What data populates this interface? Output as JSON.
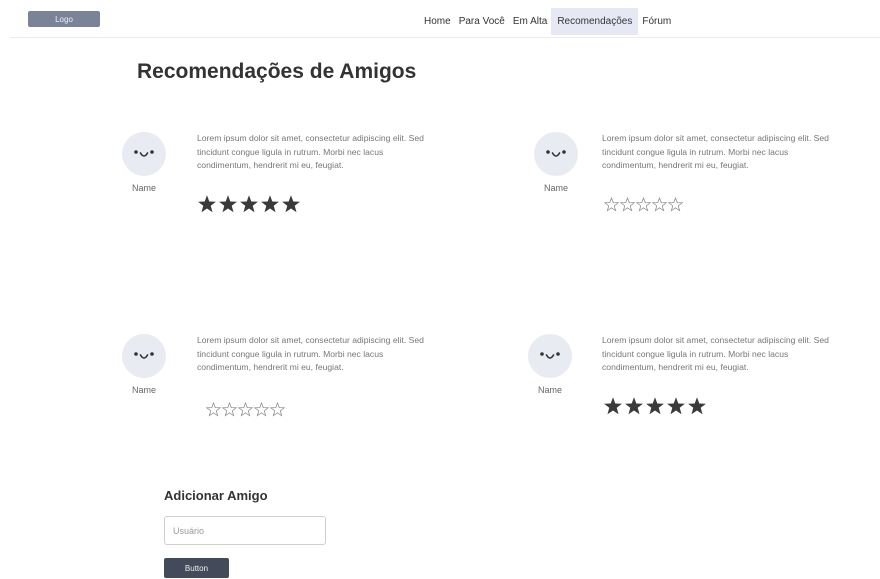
{
  "header": {
    "logo_label": "Logo",
    "nav": [
      {
        "label": "Home"
      },
      {
        "label": "Para Você"
      },
      {
        "label": "Em Alta"
      },
      {
        "label": "Recomendações",
        "active": true
      },
      {
        "label": "Fórum"
      }
    ]
  },
  "page_title": "Recomendações de Amigos",
  "cards": [
    {
      "name": "Name",
      "lines": [
        "Lorem ipsum dolor sit amet, consectetur adipiscing elit. Sed",
        "tincidunt congue ligula in rutrum. Morbi nec lacus",
        "condimentum, hendrerit mi eu, feugiat."
      ],
      "rating": 5,
      "max_rating": 5
    },
    {
      "name": "Name",
      "lines": [
        "Lorem ipsum dolor sit amet, consectetur adipiscing elit. Sed",
        "tincidunt congue ligula in rutrum. Morbi nec lacus",
        "condimentum, hendrerit mi eu, feugiat."
      ],
      "rating": 0,
      "max_rating": 5
    },
    {
      "name": "Name",
      "lines": [
        "Lorem ipsum dolor sit amet, consectetur adipiscing elit. Sed",
        "tincidunt congue ligula in rutrum. Morbi nec lacus",
        "condimentum, hendrerit mi eu, feugiat."
      ],
      "rating": 0,
      "max_rating": 5
    },
    {
      "name": "Name",
      "lines": [
        "Lorem ipsum dolor sit amet, consectetur adipiscing elit. Sed",
        "tincidunt congue ligula in rutrum. Morbi nec lacus",
        "condimentum, hendrerit mi eu, feugiat."
      ],
      "rating": 5,
      "max_rating": 5
    }
  ],
  "add_friend": {
    "title": "Adicionar Amigo",
    "input_placeholder": "Usuário",
    "input_value": "",
    "button_label": "Button"
  },
  "icons": {
    "avatar": "smiley-face-icon",
    "star_filled": "star-filled-icon",
    "star_empty": "star-outline-icon"
  },
  "colors": {
    "logo_bg": "#7b8399",
    "nav_active_bg": "#e6e9f3",
    "avatar_bg": "#e9ebf2",
    "button_bg": "#434b5a",
    "star_filled": "#3a3a3a",
    "star_empty": "#8a8a8a"
  }
}
